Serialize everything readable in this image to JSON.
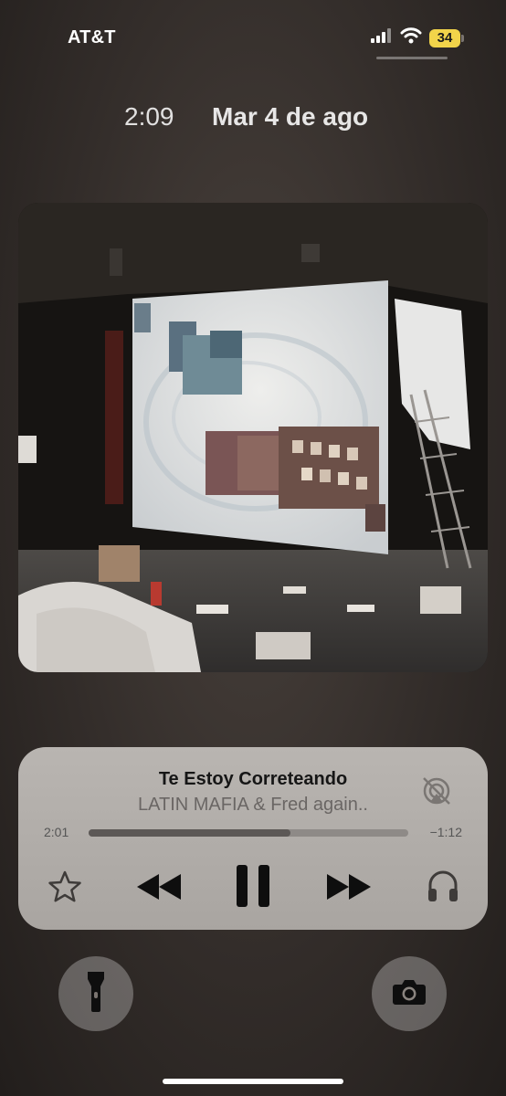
{
  "status_bar": {
    "carrier": "AT&T",
    "battery_level": "34",
    "battery_color": "#f2d44a",
    "icons": [
      "signal-icon",
      "wifi-icon",
      "battery-icon"
    ]
  },
  "lock_screen": {
    "time": "2:09",
    "date": "Mar 4 de ago"
  },
  "now_playing": {
    "title": "Te Estoy Correteando",
    "artist": "LATIN MAFIA & Fred again..",
    "elapsed": "2:01",
    "remaining": "−1:12",
    "progress": 0.63,
    "controls": [
      "star-icon",
      "rewind-icon",
      "pause-icon",
      "fast-forward-icon",
      "headphones-icon",
      "airplay-off-icon"
    ]
  },
  "quick_actions": {
    "left": "flashlight-icon",
    "right": "camera-icon"
  }
}
